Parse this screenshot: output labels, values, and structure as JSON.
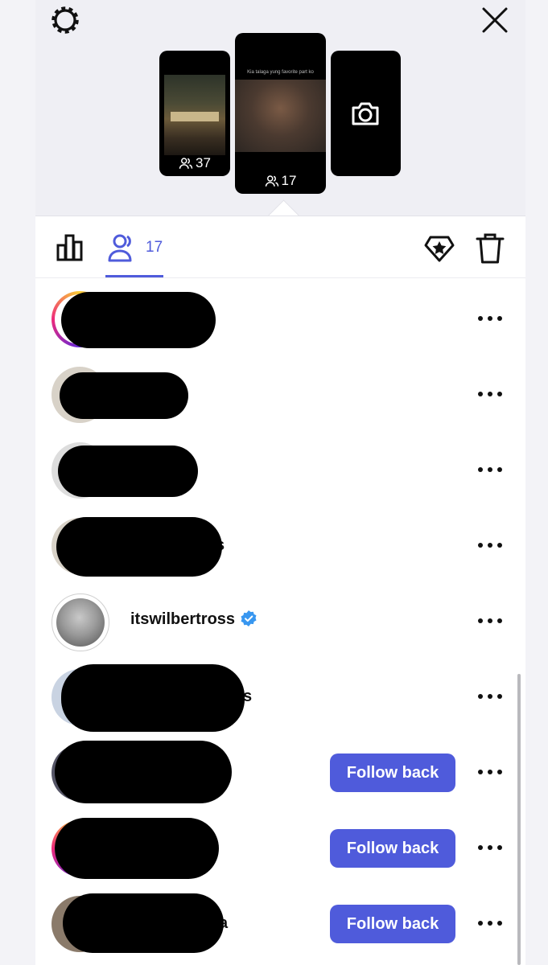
{
  "story": {
    "thumbnails": [
      {
        "views": "37",
        "caption": ""
      },
      {
        "views": "17",
        "caption": "Kia talaga yung favorite part ko"
      },
      {
        "views": ""
      }
    ]
  },
  "tabs": {
    "viewers_count": "17"
  },
  "viewers": [
    {
      "username": "",
      "tail": "",
      "follow_label": ""
    },
    {
      "username": "",
      "tail": "",
      "follow_label": ""
    },
    {
      "username": "",
      "tail": "",
      "follow_label": ""
    },
    {
      "username": "",
      "tail": "s",
      "follow_label": ""
    },
    {
      "username": "itswilbertross",
      "tail": "",
      "verified": true,
      "follow_label": ""
    },
    {
      "username": "",
      "tail": "s",
      "follow_label": ""
    },
    {
      "username": "",
      "tail": "a",
      "follow_label": "Follow back"
    },
    {
      "username": "",
      "tail": "",
      "follow_label": "Follow back"
    },
    {
      "username": "",
      "tail": "a",
      "follow_label": "Follow back"
    }
  ],
  "colors": {
    "accent": "#4f5bdb",
    "verified": "#3897f0"
  }
}
